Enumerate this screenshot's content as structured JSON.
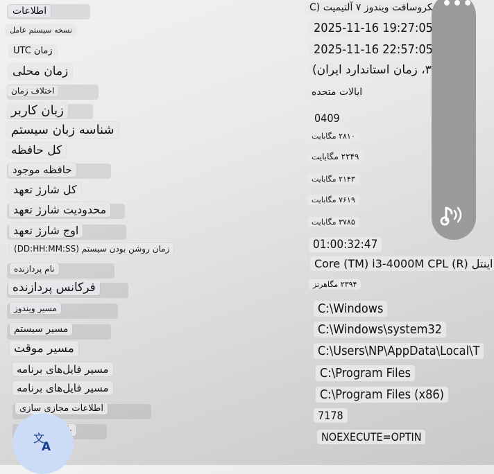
{
  "labels": [
    "اطلاعات",
    "نسخه سیستم عامل",
    "زمان UTC",
    "زمان محلی",
    "اختلاف زمان",
    "زبان کاربر",
    "شناسه زبان سیستم",
    "کل حافظه",
    "حافظه موجود",
    "کل شارژ تعهد",
    "محدودیت شارژ تعهد",
    "اوج شارژ تعهد",
    "زمان روشن بودن سیستم (DD:HH:MM:SS)",
    "نام پردازنده",
    "فرکانس پردازنده",
    "مسیر ویندوز",
    "مسیر سیستم",
    "مسیر موقت",
    "مسیر فایل‌های برنامه",
    "مسیر فایل‌های برنامه",
    "اطلاعات مجازی سازی",
    "پا"
  ],
  "values": [
    "مایکروسافت ویندوز ۷ آلتیمیت (C",
    "2025-11-16 19:27:05",
    "2025-11-16 22:57:05",
    "۳:۰، زمان استاندارد ایران)",
    "ایالات متحده",
    "0409",
    "۲۸۱۰ مگابایت",
    "۲۲۴۹ مگابایت",
    "۲۱۴۳ مگابایت",
    "۷۶۱۹ مگابایت",
    "۳۷۸۵ مگابایت",
    "01:00:32:47",
    "اینتل (R) Core (TM) i3-4000M CPL",
    "۲۳۹۴ مگاهرتز",
    "C:\\Windows",
    "C:\\Windows\\system32",
    "C:\\Users\\NP\\AppData\\Local\\T",
    "C:\\Program Files",
    "C:\\Program Files (x86)",
    "7178",
    "NOEXECUTE=OPTIN"
  ],
  "icons": {
    "more": "more-options-icon",
    "speaker": "speaker-icon",
    "translate": "translate-icon"
  },
  "colors": {
    "panel": "#9a9a9a",
    "fab": "#cddcf6",
    "fab_icon": "#1a3e8c"
  }
}
